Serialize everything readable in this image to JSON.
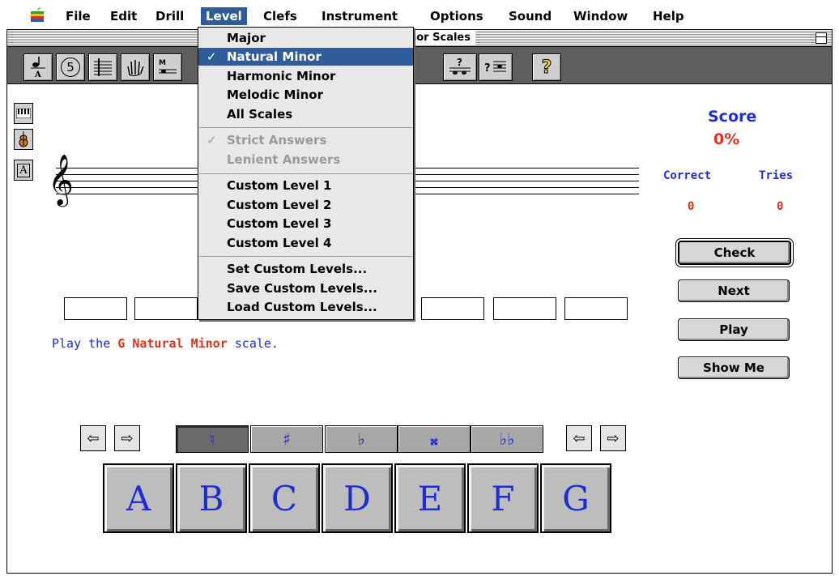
{
  "menubar": {
    "items": [
      "File",
      "Edit",
      "Drill",
      "Level",
      "Clefs",
      "Instrument",
      "Options",
      "Sound",
      "Window",
      "Help"
    ],
    "active": "Level"
  },
  "window": {
    "title": "nor Scales"
  },
  "level_menu": {
    "groups": {
      "scales": [
        "Major",
        "Natural Minor",
        "Harmonic Minor",
        "Melodic Minor",
        "All Scales"
      ],
      "answers": [
        "Strict Answers",
        "Lenient Answers"
      ],
      "custom": [
        "Custom Level  1",
        "Custom Level  2",
        "Custom Level  3",
        "Custom Level  4"
      ],
      "manage": [
        "Set Custom Levels...",
        "Save Custom Levels...",
        "Load Custom Levels..."
      ]
    },
    "checkmark": "✓",
    "selected": "Natural Minor",
    "checked_answers": "Strict Answers"
  },
  "toolbar": {
    "icons": [
      "note-a-icon",
      "five-circle-icon",
      "staff-clef-icon",
      "hand-icon",
      "scale-icon",
      "interval-question-icon",
      "question-staff-icon",
      "help-icon"
    ],
    "five": "5",
    "question": "?"
  },
  "side_buttons": [
    "keyboard-icon",
    "violin-icon",
    "letter-a-icon"
  ],
  "side_letter": "A",
  "score": {
    "label": "Score",
    "value": "0%",
    "correct_label": "Correct",
    "tries_label": "Tries",
    "correct": "0",
    "tries": "0"
  },
  "buttons": {
    "check": "Check",
    "next": "Next",
    "play": "Play",
    "show_me": "Show Me"
  },
  "prompt": {
    "prefix": "Play the ",
    "key": "G Natural Minor",
    "suffix": " scale."
  },
  "accidentals": {
    "natural": "♮",
    "sharp": "♯",
    "flat": "♭",
    "double_sharp": "𝄪",
    "double_flat": "♭♭",
    "selected": "natural"
  },
  "arrows": {
    "left": "⇦",
    "right": "⇨"
  },
  "letters": [
    "A",
    "B",
    "C",
    "D",
    "E",
    "F",
    "G"
  ],
  "colors": {
    "accent_blue": "#1e2ed0",
    "accent_red": "#e0301e",
    "menu_highlight": "#2f5d9a"
  }
}
